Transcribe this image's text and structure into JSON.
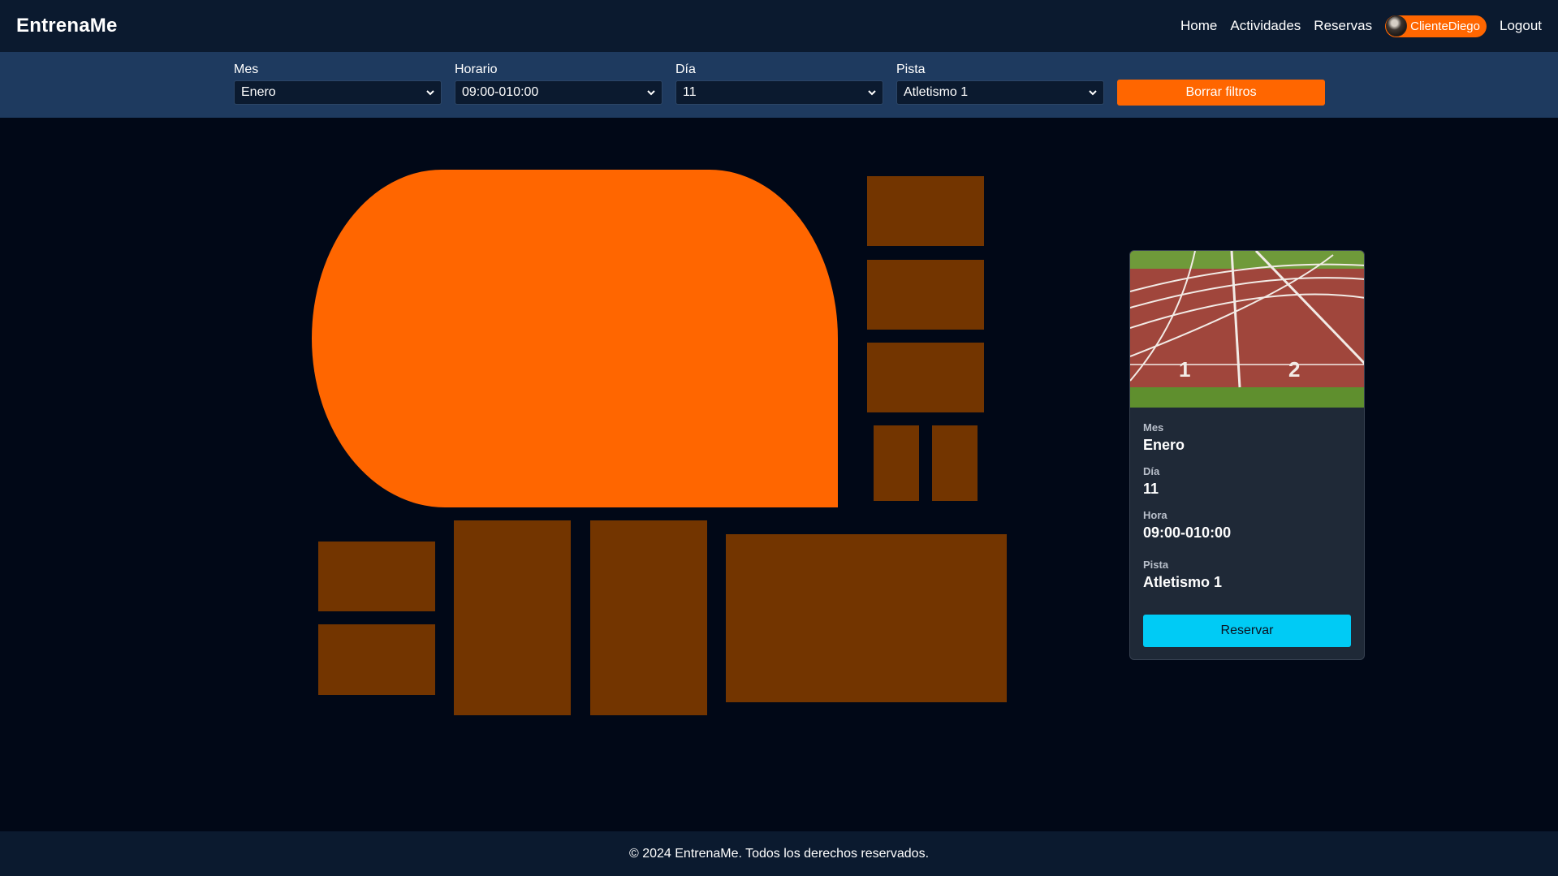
{
  "app": {
    "brand": "EntrenaMe"
  },
  "nav": {
    "home": "Home",
    "activities": "Actividades",
    "reservations": "Reservas",
    "user": "ClienteDiego",
    "logout": "Logout"
  },
  "filters": {
    "month": {
      "label": "Mes",
      "value": "Enero"
    },
    "schedule": {
      "label": "Horario",
      "value": "09:00-010:00"
    },
    "day": {
      "label": "Día",
      "value": "11"
    },
    "court": {
      "label": "Pista",
      "value": "Atletismo 1"
    },
    "clear_label": "Borrar filtros"
  },
  "colors": {
    "accent": "#ff6600",
    "shape_inactive": "#733500",
    "reserve": "#00cbf5"
  },
  "card": {
    "month_label": "Mes",
    "month_value": "Enero",
    "day_label": "Día",
    "day_value": "11",
    "hour_label": "Hora",
    "hour_value": "09:00-010:00",
    "court_label": "Pista",
    "court_value": "Atletismo 1",
    "reserve_label": "Reservar",
    "lane_numbers": [
      "1",
      "2"
    ]
  },
  "footer": {
    "text": "© 2024 EntrenaMe. Todos los derechos reservados."
  }
}
